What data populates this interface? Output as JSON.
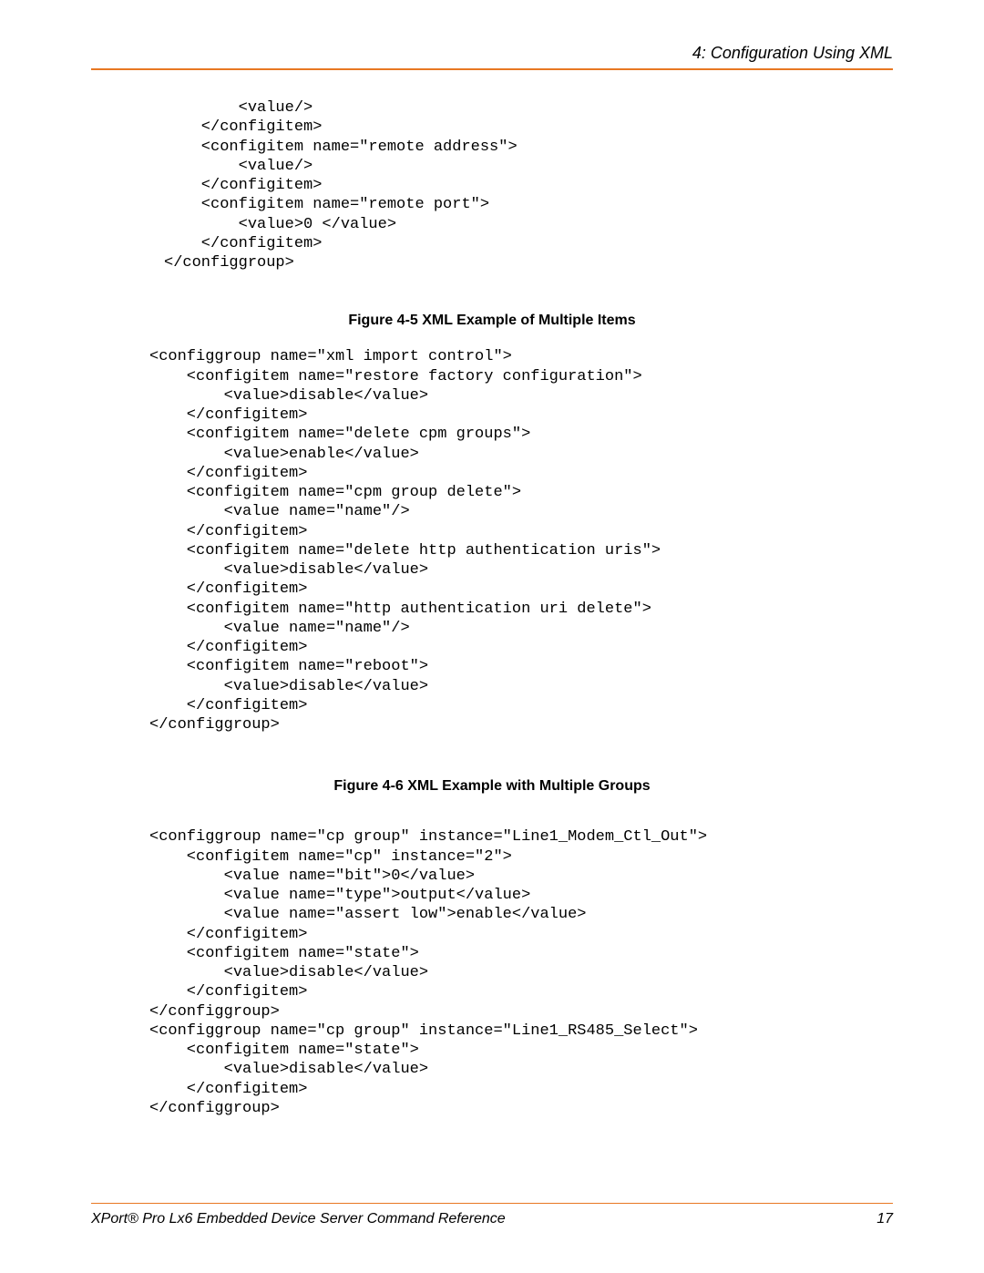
{
  "header": {
    "chapter": "4: Configuration Using XML"
  },
  "code1": "        <value/>\n    </configitem>\n    <configitem name=\"remote address\">\n        <value/>\n    </configitem>\n    <configitem name=\"remote port\">\n        <value>0 </value>\n    </configitem>\n</configgroup>",
  "figure1": "Figure 4-5  XML Example of Multiple Items",
  "code2": "<configgroup name=\"xml import control\">\n    <configitem name=\"restore factory configuration\">\n        <value>disable</value>\n    </configitem>\n    <configitem name=\"delete cpm groups\">\n        <value>enable</value>\n    </configitem>\n    <configitem name=\"cpm group delete\">\n        <value name=\"name\"/>\n    </configitem>\n    <configitem name=\"delete http authentication uris\">\n        <value>disable</value>\n    </configitem>\n    <configitem name=\"http authentication uri delete\">\n        <value name=\"name\"/>\n    </configitem>\n    <configitem name=\"reboot\">\n        <value>disable</value>\n    </configitem>\n</configgroup>",
  "figure2": "Figure 4-6  XML Example with Multiple Groups",
  "code3": "<configgroup name=\"cp group\" instance=\"Line1_Modem_Ctl_Out\">\n    <configitem name=\"cp\" instance=\"2\">\n        <value name=\"bit\">0</value>\n        <value name=\"type\">output</value>\n        <value name=\"assert low\">enable</value>\n    </configitem>\n    <configitem name=\"state\">\n        <value>disable</value>\n    </configitem>\n</configgroup>\n<configgroup name=\"cp group\" instance=\"Line1_RS485_Select\">\n    <configitem name=\"state\">\n        <value>disable</value>\n    </configitem>\n</configgroup>",
  "footer": {
    "title": "XPort® Pro Lx6 Embedded Device Server Command Reference",
    "page": "17"
  }
}
